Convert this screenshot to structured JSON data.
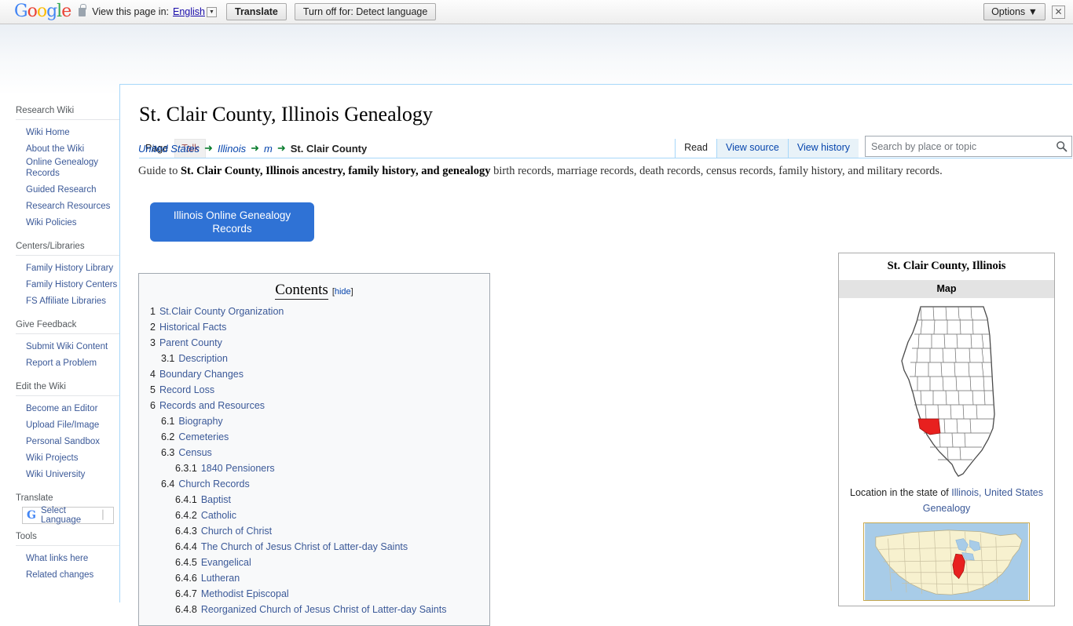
{
  "translate_bar": {
    "logo_text": "Google",
    "lock_icon": "lock-icon",
    "view_label": "View this page in:",
    "language_value": "English",
    "caret_icon": "chevron-down-icon",
    "translate_button": "Translate",
    "turn_off_button": "Turn off for: Detect language",
    "options_button": "Options ▼",
    "close_icon": "✕"
  },
  "sidebar": {
    "sections": [
      {
        "heading": "Research Wiki",
        "items": [
          "Wiki Home",
          "About the Wiki",
          "Online Genealogy Records",
          "Guided Research",
          "Research Resources",
          "Wiki Policies"
        ]
      },
      {
        "heading": "Centers/Libraries",
        "items": [
          "Family History Library",
          "Family History Centers",
          "FS Affiliate Libraries"
        ]
      },
      {
        "heading": "Give Feedback",
        "items": [
          "Submit Wiki Content",
          "Report a Problem"
        ]
      },
      {
        "heading": "Edit the Wiki",
        "items": [
          "Become an Editor",
          "Upload File/Image",
          "Personal Sandbox",
          "Wiki Projects",
          "Wiki University"
        ]
      },
      {
        "heading": "Translate",
        "items": []
      },
      {
        "heading": "Tools",
        "items": [
          "What links here",
          "Related changes"
        ]
      }
    ],
    "language_widget": {
      "logo": "G",
      "label": "Select Language",
      "caret": "▏"
    }
  },
  "page": {
    "title": "St. Clair County, Illinois Genealogy",
    "namespace_tabs": [
      {
        "label": "Page",
        "active": true
      },
      {
        "label": "Talk",
        "active": false
      }
    ],
    "action_tabs": [
      {
        "label": "Read",
        "active": true
      },
      {
        "label": "View source",
        "active": false
      },
      {
        "label": "View history",
        "active": false
      }
    ],
    "search": {
      "placeholder": "Search by place or topic",
      "value": "",
      "icon": "search-icon"
    },
    "breadcrumb": [
      {
        "label": "United States",
        "type": "link"
      },
      {
        "label": "Illinois",
        "type": "link"
      },
      {
        "label": "m",
        "type": "link"
      },
      {
        "label": "St. Clair County",
        "type": "current"
      }
    ],
    "breadcrumb_arrow": "➜",
    "guide": {
      "prefix": "Guide to ",
      "bold": "St. Clair County, Illinois ancestry, family history, and genealogy",
      "suffix": " birth records, marriage records, death records, census records, family history, and military records."
    },
    "cta_button": "Illinois Online Genealogy Records"
  },
  "toc": {
    "title": "Contents",
    "hide_open": "[",
    "hide_label": "hide",
    "hide_close": "]",
    "entries": [
      {
        "num": "1",
        "label": "St.Clair County Organization",
        "level": 0
      },
      {
        "num": "2",
        "label": "Historical Facts",
        "level": 0
      },
      {
        "num": "3",
        "label": "Parent County",
        "level": 0
      },
      {
        "num": "3.1",
        "label": "Description",
        "level": 1
      },
      {
        "num": "4",
        "label": "Boundary Changes",
        "level": 0
      },
      {
        "num": "5",
        "label": "Record Loss",
        "level": 0
      },
      {
        "num": "6",
        "label": "Records and Resources",
        "level": 0
      },
      {
        "num": "6.1",
        "label": "Biography",
        "level": 1
      },
      {
        "num": "6.2",
        "label": "Cemeteries",
        "level": 1
      },
      {
        "num": "6.3",
        "label": "Census",
        "level": 1
      },
      {
        "num": "6.3.1",
        "label": "1840 Pensioners",
        "level": 2
      },
      {
        "num": "6.4",
        "label": "Church Records",
        "level": 1
      },
      {
        "num": "6.4.1",
        "label": "Baptist",
        "level": 2
      },
      {
        "num": "6.4.2",
        "label": "Catholic",
        "level": 2
      },
      {
        "num": "6.4.3",
        "label": "Church of Christ",
        "level": 2
      },
      {
        "num": "6.4.4",
        "label": "The Church of Jesus Christ of Latter-day Saints",
        "level": 2
      },
      {
        "num": "6.4.5",
        "label": "Evangelical",
        "level": 2
      },
      {
        "num": "6.4.6",
        "label": "Lutheran",
        "level": 2
      },
      {
        "num": "6.4.7",
        "label": "Methodist Episcopal",
        "level": 2
      },
      {
        "num": "6.4.8",
        "label": "Reorganized Church of Jesus Christ of Latter-day Saints",
        "level": 2
      }
    ]
  },
  "infobox": {
    "title": "St. Clair County, Illinois",
    "subheader": "Map",
    "county_map_alt": "illinois-county-map",
    "caption_prefix": "Location in the state of ",
    "caption_link": "Illinois, United States Genealogy",
    "us_map_alt": "united-states-map",
    "highlight_color": "#e8201f"
  }
}
